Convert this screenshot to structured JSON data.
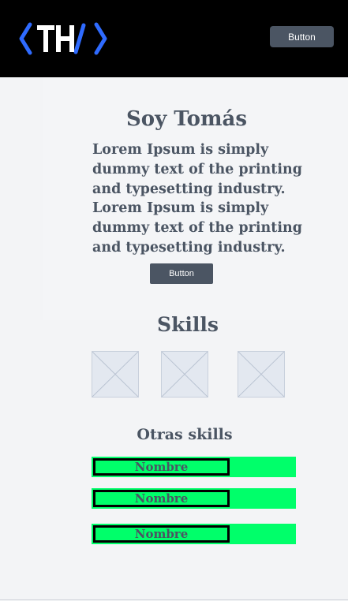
{
  "header": {
    "logo_text": "<TH/>",
    "button_label": "Button"
  },
  "hero": {
    "title": "Soy Tomás",
    "paragraph_1": "Lorem Ipsum is simply dummy text of the printing and typesetting industry.",
    "paragraph_2": "Lorem Ipsum is simply dummy text of the printing and typesetting industry.",
    "button_label": "Button"
  },
  "skills": {
    "title": "Skills",
    "images": [
      "image-placeholder",
      "image-placeholder",
      "image-placeholder"
    ]
  },
  "otras_skills": {
    "title": "Otras skills",
    "items": [
      {
        "label": "Nombre",
        "level": 0.67
      },
      {
        "label": "Nombre",
        "level": 0.67
      },
      {
        "label": "Nombre",
        "level": 0.67
      }
    ]
  },
  "colors": {
    "header_bg": "#000000",
    "logo_blue": "#2f6bff",
    "button_bg": "#4b5563",
    "text": "#4b5563",
    "skill_bar": "#00ff6a",
    "page_bg": "#f3f4f6"
  }
}
